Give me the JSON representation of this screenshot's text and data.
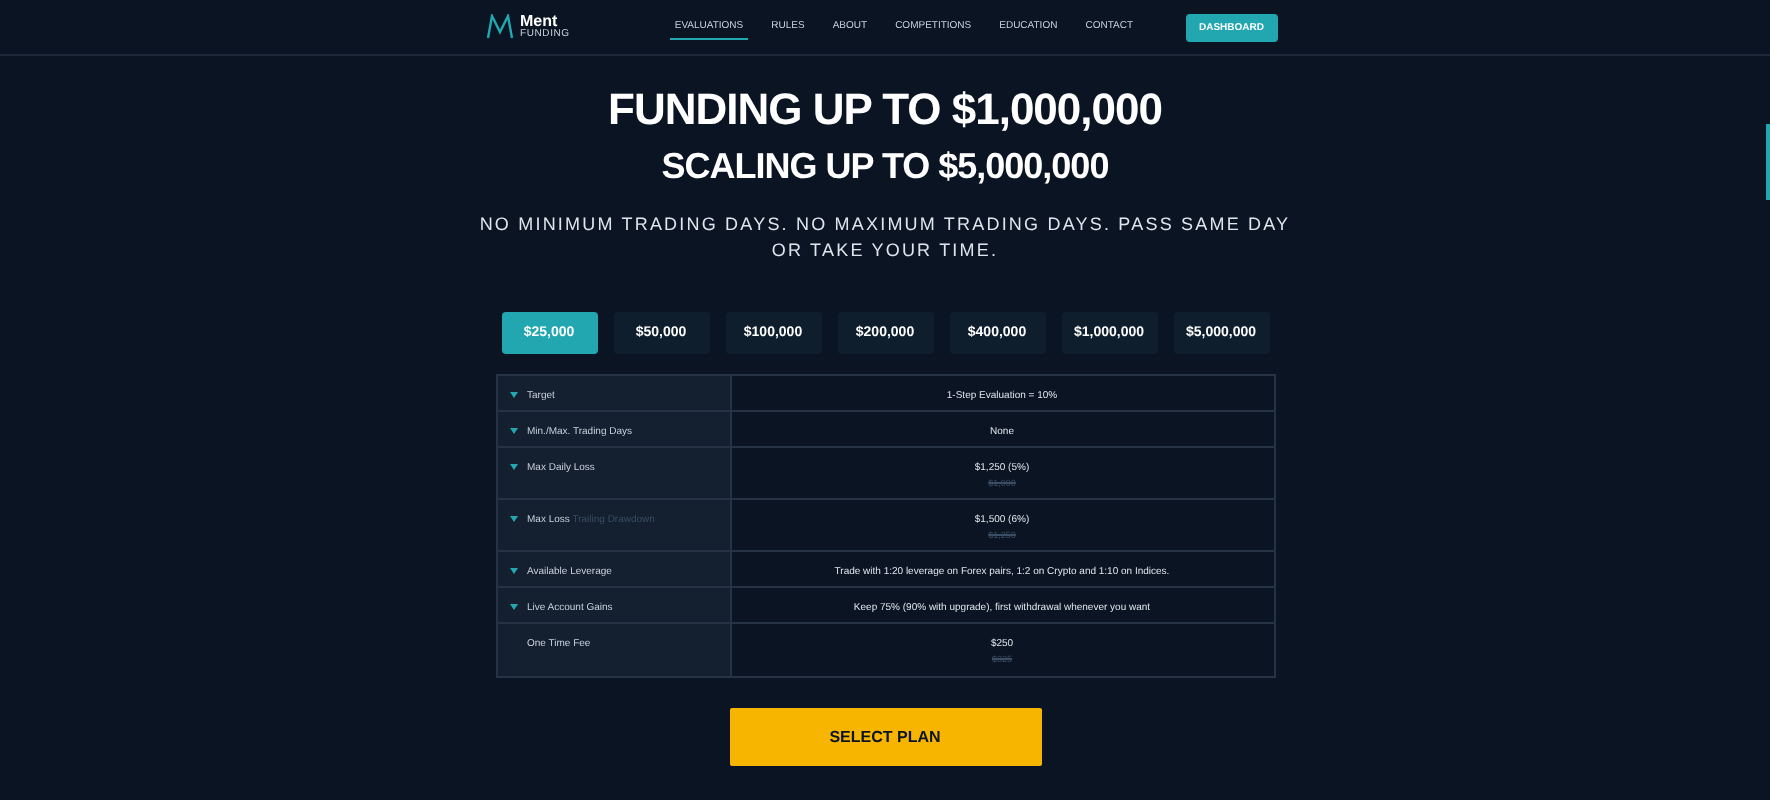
{
  "logo": {
    "name": "Ment",
    "subtitle": "FUNDING"
  },
  "nav": [
    {
      "label": "EVALUATIONS",
      "selected": true
    },
    {
      "label": "RULES",
      "selected": false
    },
    {
      "label": "ABOUT",
      "selected": false
    },
    {
      "label": "COMPETITIONS",
      "selected": false
    },
    {
      "label": "EDUCATION",
      "selected": false
    },
    {
      "label": "CONTACT",
      "selected": false
    }
  ],
  "dashboard_button": "DASHBOARD",
  "headline": "FUNDING UP TO $1,000,000",
  "subheadline": "SCALING UP TO $5,000,000",
  "tagline": "NO MINIMUM TRADING DAYS. NO MAXIMUM TRADING DAYS. PASS SAME DAY OR TAKE YOUR TIME.",
  "plans": [
    {
      "label": "$25,000",
      "selected": true
    },
    {
      "label": "$50,000",
      "selected": false
    },
    {
      "label": "$100,000",
      "selected": false
    },
    {
      "label": "$200,000",
      "selected": false
    },
    {
      "label": "$400,000",
      "selected": false
    },
    {
      "label": "$1,000,000",
      "selected": false
    },
    {
      "label": "$5,000,000",
      "selected": false
    }
  ],
  "rows": [
    {
      "label": "Target",
      "expandable": true,
      "value": "1-Step Evaluation = 10%"
    },
    {
      "label": "Min./Max. Trading Days",
      "expandable": true,
      "value": "None"
    },
    {
      "label": "Max Daily Loss",
      "expandable": true,
      "value": "$1,250 (5%)",
      "old_value": "$1,000"
    },
    {
      "label": "Max Loss",
      "note": "Trailing Drawdown",
      "expandable": true,
      "value": "$1,500 (6%)",
      "old_value": "$1,250"
    },
    {
      "label": "Available Leverage",
      "expandable": true,
      "value": "Trade with 1:20 leverage on Forex pairs, 1:2 on Crypto and 1:10 on Indices."
    },
    {
      "label": "Live Account Gains",
      "expandable": true,
      "value": "Keep 75% (90% with upgrade), first withdrawal whenever you want"
    },
    {
      "label": "One Time Fee",
      "expandable": false,
      "value": "$250",
      "old_value": "$325"
    }
  ],
  "select_button": "SELECT PLAN"
}
